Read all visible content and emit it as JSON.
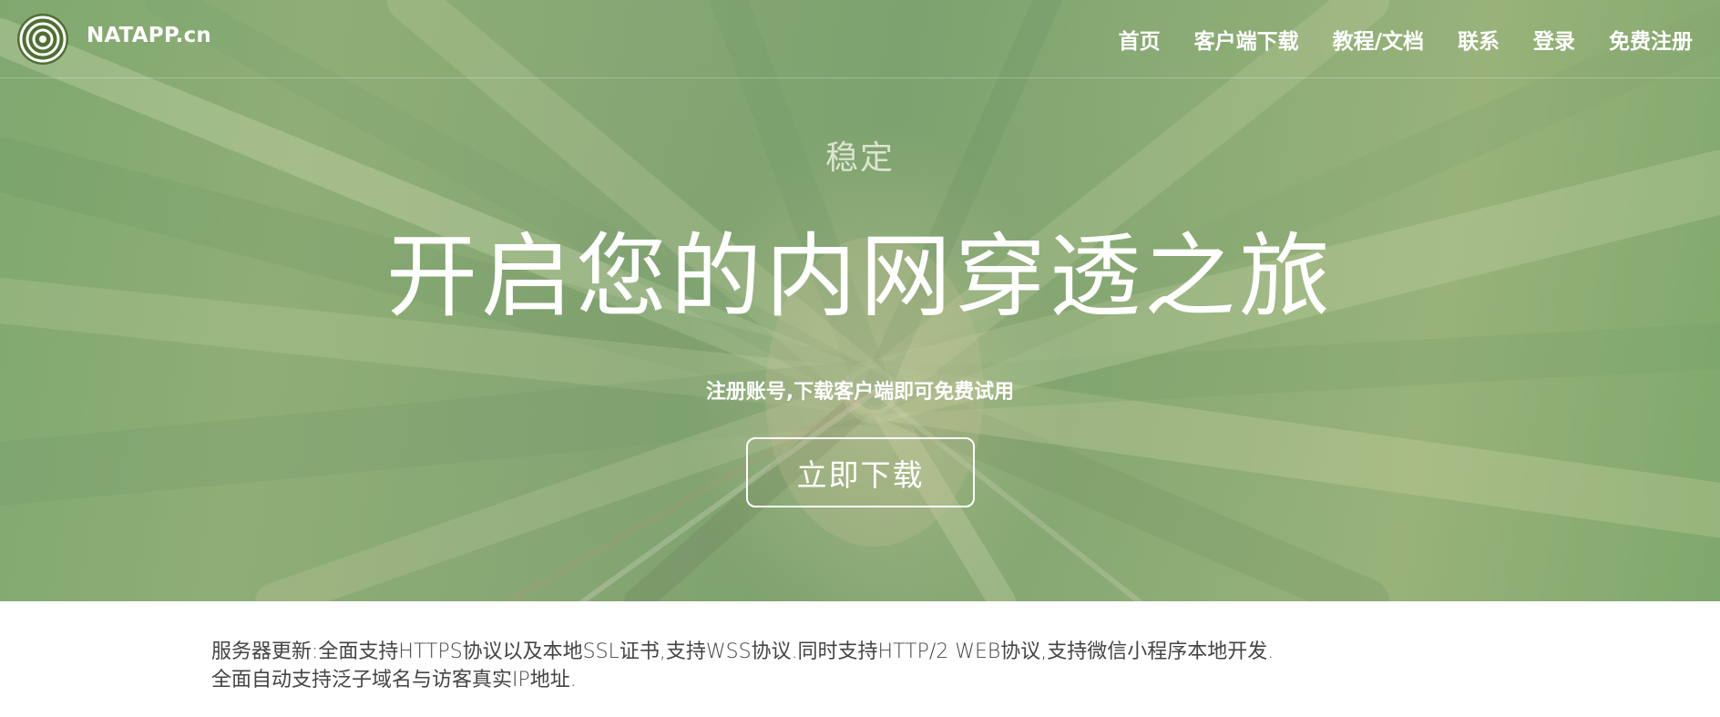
{
  "header": {
    "brand": "NATAPP.cn",
    "nav": [
      "首页",
      "客户端下载",
      "教程/文档",
      "联系",
      "登录",
      "免费注册"
    ]
  },
  "hero": {
    "tagline": "稳定",
    "headline": "开启您的内网穿透之旅",
    "subtitle": "注册账号,下载客户端即可免费试用",
    "cta_label": "立即下载"
  },
  "announcement": {
    "line1": "服务器更新:全面支持HTTPS协议以及本地SSL证书,支持WSS协议.同时支持HTTP/2 WEB协议,支持微信小程序本地开发.",
    "line2": "全面自动支持泛子域名与访客真实IP地址."
  },
  "icons": {
    "logo": "concentric-rings-logo-icon"
  },
  "colors": {
    "hero_green": "#86a774",
    "text_white": "#ffffff",
    "body_text": "#444444"
  }
}
